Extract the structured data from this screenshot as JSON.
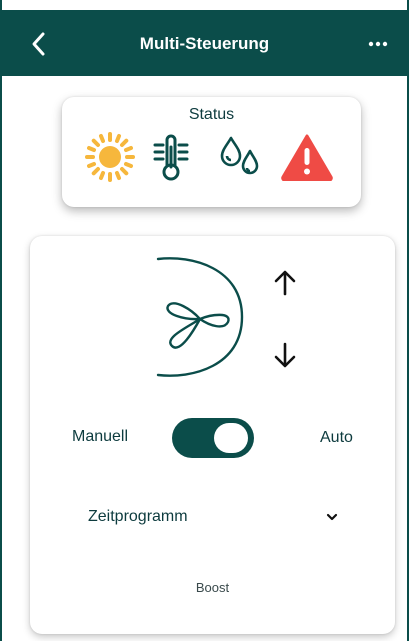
{
  "header": {
    "title": "Multi-Steuerung",
    "back_icon": "chevron-left-icon",
    "more_icon": "more-horizontal-icon"
  },
  "status": {
    "label": "Status",
    "icons": [
      "sun-icon",
      "thermometer-icon",
      "humidity-icon",
      "warning-icon"
    ]
  },
  "fan": {
    "icon": "fan-icon",
    "up_icon": "arrow-up-icon",
    "down_icon": "arrow-down-icon"
  },
  "mode": {
    "manual_label": "Manuell",
    "auto_label": "Auto",
    "toggle_on": true
  },
  "schedule": {
    "label": "Zeitprogramm",
    "chevron_icon": "chevron-down-icon"
  },
  "boost": {
    "label": "Boost"
  },
  "colors": {
    "primary": "#0b4d4a",
    "sun": "#f6b73c",
    "warning": "#ef4b45"
  }
}
